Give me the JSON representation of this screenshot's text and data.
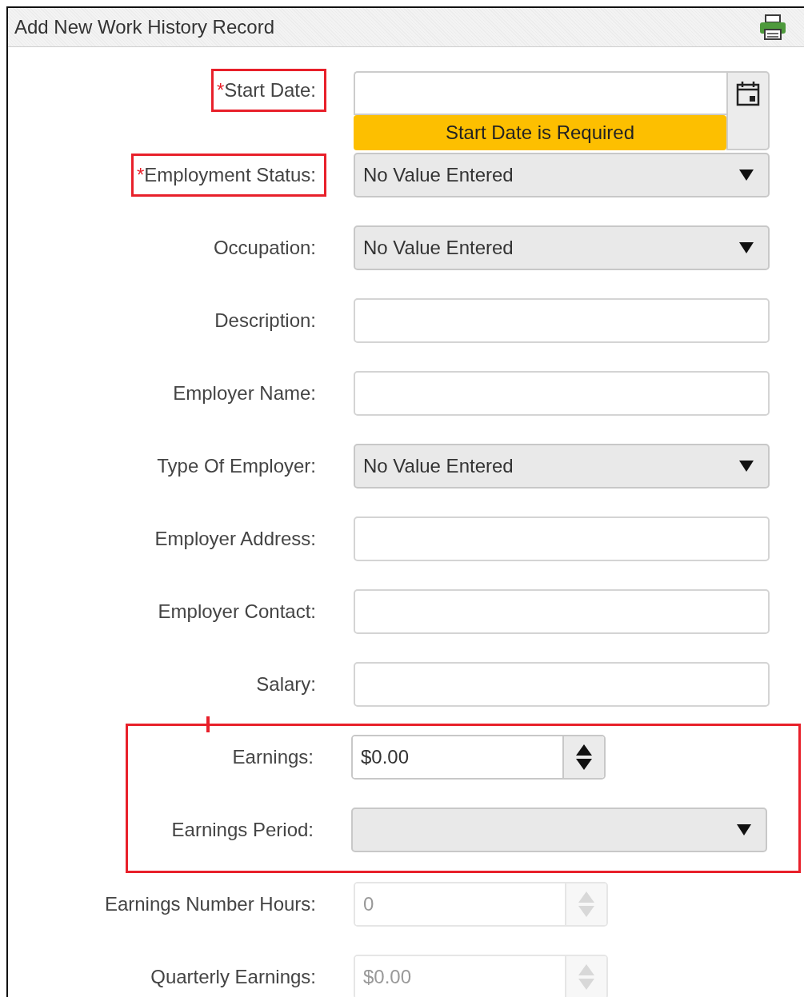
{
  "header": {
    "title": "Add New Work History Record"
  },
  "fields": [
    {
      "kind": "date",
      "label": "Start Date:",
      "required_mark": "*",
      "highlighted": true,
      "disabled": false,
      "error": "Start Date is Required"
    },
    {
      "kind": "select",
      "label": "Employment Status:",
      "required_mark": "*",
      "highlighted": true,
      "disabled": false,
      "value": "No Value Entered"
    },
    {
      "kind": "select",
      "label": "Occupation:",
      "highlighted": false,
      "disabled": false,
      "value": "No Value Entered"
    },
    {
      "kind": "text",
      "label": "Description:",
      "highlighted": false,
      "disabled": false
    },
    {
      "kind": "text",
      "label": "Employer Name:",
      "highlighted": false,
      "disabled": false
    },
    {
      "kind": "select",
      "label": "Type Of Employer:",
      "highlighted": false,
      "disabled": false,
      "value": "No Value Entered"
    },
    {
      "kind": "text",
      "label": "Employer Address:",
      "highlighted": false,
      "disabled": false
    },
    {
      "kind": "text",
      "label": "Employer Contact:",
      "highlighted": false,
      "disabled": false
    },
    {
      "kind": "text",
      "label": "Salary:",
      "highlighted": false,
      "disabled": false
    },
    {
      "kind": "group",
      "highlighted": true,
      "fields": [
        {
          "kind": "number",
          "label": "Earnings:",
          "highlighted": false,
          "disabled": false,
          "value": "$0.00"
        },
        {
          "kind": "select",
          "label": "Earnings Period:",
          "highlighted": false,
          "disabled": false
        }
      ]
    },
    {
      "kind": "number",
      "label": "Earnings Number Hours:",
      "highlighted": false,
      "disabled": true,
      "value": "0"
    },
    {
      "kind": "number",
      "label": "Quarterly Earnings:",
      "highlighted": false,
      "disabled": true,
      "value": "$0.00"
    }
  ]
}
